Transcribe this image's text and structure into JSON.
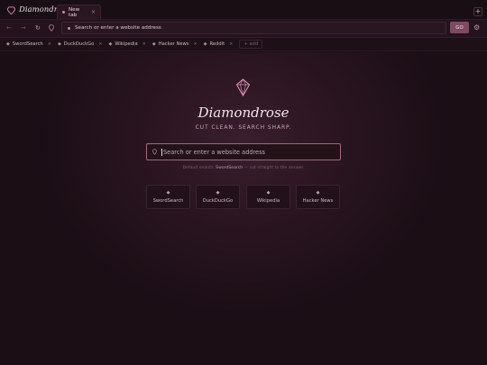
{
  "app": {
    "name": "Diamondrose"
  },
  "tabs": [
    {
      "label": "New tab",
      "close": "×"
    }
  ],
  "titlebar": {
    "new_tab": "+"
  },
  "nav": {
    "back": "←",
    "forward": "→",
    "reload": "↻",
    "go_label": "GO",
    "settings": "⚙"
  },
  "url": {
    "placeholder": "Search or enter a website address"
  },
  "bookmarks": {
    "items": [
      {
        "label": "SwordSearch",
        "close": "×"
      },
      {
        "label": "DuckDuckGo",
        "close": "×"
      },
      {
        "label": "Wikipedia",
        "close": "×"
      },
      {
        "label": "Hacker News",
        "close": "×"
      },
      {
        "label": "Reddit",
        "close": "×"
      }
    ],
    "add_label": "+ add",
    "icon": "◆"
  },
  "hero": {
    "title": "Diamondrose",
    "tagline": "CUT CLEAN. SEARCH SHARP."
  },
  "search": {
    "placeholder": "Search or enter a website address"
  },
  "hint": {
    "prefix": "Default search: ",
    "engine": "SwordSearch",
    "suffix": " — cut straight to the answer."
  },
  "quick_links": [
    {
      "label": "SwordSearch",
      "icon": "◆"
    },
    {
      "label": "DuckDuckGo",
      "icon": "◆"
    },
    {
      "label": "Wikipedia",
      "icon": "◆"
    },
    {
      "label": "Hacker News",
      "icon": "◆"
    }
  ],
  "colors": {
    "accent": "#7d4a61",
    "background": "#1b0f16",
    "highlight": "#c39ab0"
  }
}
